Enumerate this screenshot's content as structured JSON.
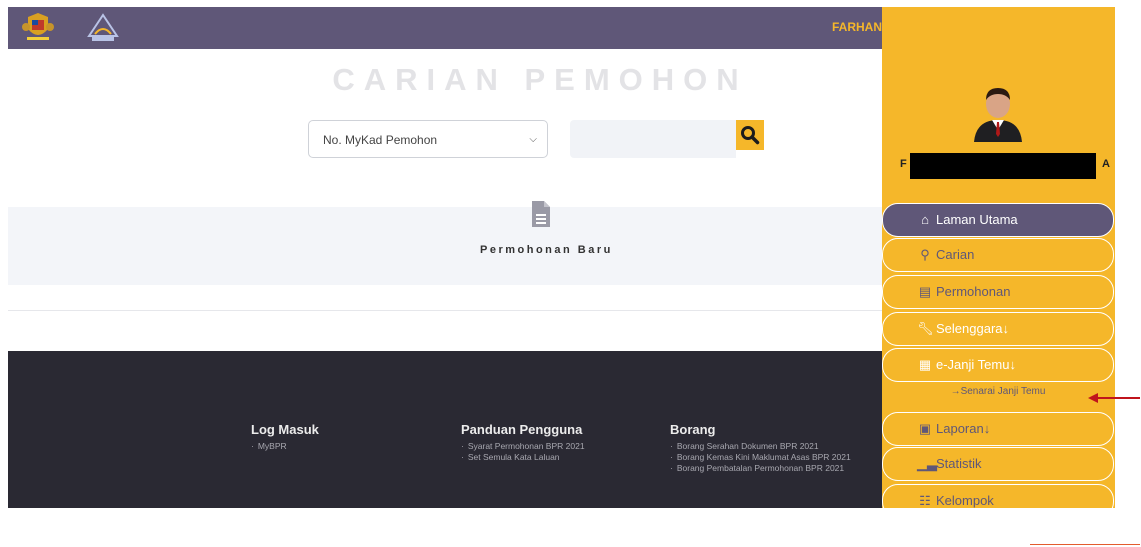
{
  "header": {
    "user_text": "FARHAN",
    "crest_icon": "malaysia-crest-icon",
    "logo_icon": "lhdn-malaysia-logo-icon"
  },
  "search": {
    "title": "CARIAN PEMOHON",
    "select_value": "No. MyKad Pemohon",
    "input_placeholder": "",
    "button_icon": "search-icon"
  },
  "main": {
    "card_label": "Permohonan Baru",
    "card_icon": "document-icon"
  },
  "footer": {
    "columns": [
      {
        "title": "Log Masuk",
        "items": [
          "MyBPR"
        ]
      },
      {
        "title": "Panduan Pengguna",
        "items": [
          "Syarat Permohonan BPR 2021",
          "Set Semula Kata Laluan"
        ]
      },
      {
        "title": "Borang",
        "items": [
          "Borang Serahan Dokumen BPR 2021",
          "Borang Kemas Kini Maklumat Asas BPR 2021",
          "Borang Pembatalan Permohonan BPR 2021"
        ]
      }
    ]
  },
  "sidebar": {
    "user_first_letter": "F",
    "user_last_letter": "A",
    "items": [
      {
        "label": "Laman Utama",
        "icon": "home-icon"
      },
      {
        "label": "Carian",
        "icon": "search-icon"
      },
      {
        "label": "Permohonan",
        "icon": "file-icon"
      },
      {
        "label": "Selenggara↓",
        "icon": "wrench-icon"
      },
      {
        "label": "e-Janji Temu↓",
        "icon": "calendar-icon"
      },
      {
        "label": "Laporan↓",
        "icon": "report-icon"
      },
      {
        "label": "Statistik",
        "icon": "bar-chart-icon"
      },
      {
        "label": "Kelompok",
        "icon": "group-icon"
      }
    ],
    "submenu_label": "→Senarai Janji Temu"
  },
  "colors": {
    "accent": "#f5b72a",
    "header_bg": "#5f5778",
    "footer_bg": "#2a2933",
    "annotation_arrow": "#c0141c"
  }
}
